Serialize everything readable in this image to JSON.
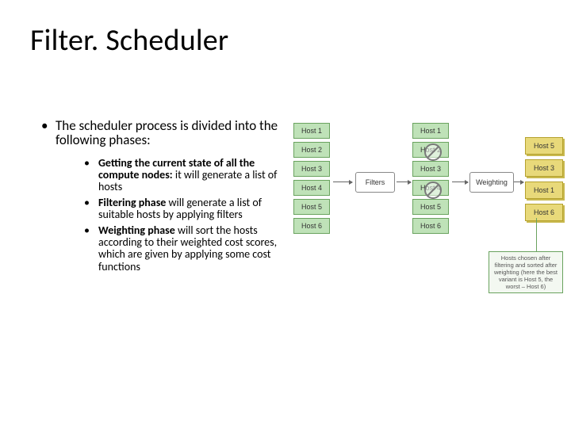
{
  "title": "Filter. Scheduler",
  "intro": "The scheduler process is divided into the following phases:",
  "bullets": [
    {
      "bold": "Getting the current state of all the compute nodes:",
      "rest": " it will generate a list of hosts"
    },
    {
      "bold": "Filtering phase",
      "rest": " will generate a list of suitable hosts by applying filters"
    },
    {
      "bold": "Weighting phase",
      "rest": " will sort the hosts according to their weighted cost scores, which are given by applying some cost functions"
    }
  ],
  "diagram": {
    "col1": [
      "Host 1",
      "Host 2",
      "Host 3",
      "Host 4",
      "Host 5",
      "Host 6"
    ],
    "col2": [
      {
        "label": "Host 1",
        "blocked": false
      },
      {
        "label": "Host 2",
        "blocked": true
      },
      {
        "label": "Host 3",
        "blocked": false
      },
      {
        "label": "Host 4",
        "blocked": true
      },
      {
        "label": "Host 5",
        "blocked": false
      },
      {
        "label": "Host 6",
        "blocked": false
      }
    ],
    "col3": [
      "Host 5",
      "Host 3",
      "Host 1",
      "Host 6"
    ],
    "stage_filters": "Filters",
    "stage_weighting": "Weighting",
    "callout": "Hosts chosen after filtering and sorted after weighting (here the best variant is Host 5, the worst – Host 6)"
  }
}
